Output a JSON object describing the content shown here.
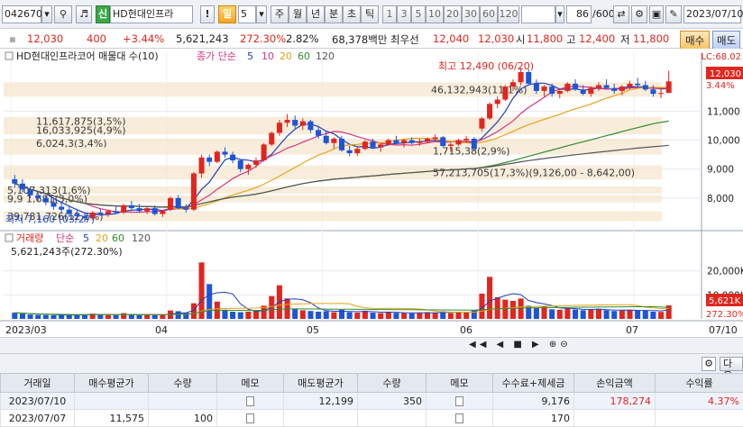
{
  "toolbar": {
    "code": "042670",
    "brand_badge": "신",
    "stock_name": "HD현대인프라",
    "period_active": "일",
    "period_count": "5",
    "periods": [
      "주",
      "월",
      "년",
      "분",
      "초",
      "틱"
    ],
    "minute_buttons": [
      "1",
      "3",
      "5",
      "10",
      "20",
      "30",
      "60",
      "120"
    ],
    "count_value": "86",
    "count_total": "/600",
    "date": "2023/07/10"
  },
  "quote": {
    "price": "12,030",
    "change": "400",
    "change_pct": "+3.44%",
    "volume": "5,621,243",
    "volume_ratio": "272.30%",
    "turnover_pct": "2.82%",
    "amount": "68,378백만",
    "priority_ask_label": "최우선",
    "priority_ask": "12,040",
    "priority_bid": "12,030",
    "open_label": "시",
    "open": "11,800",
    "high_label": "고",
    "high": "12,400",
    "low_label": "저",
    "low": "11,800",
    "buy_label": "매수",
    "sell_label": "매도"
  },
  "chart": {
    "price_title": "HD현대인프라코어 매물대 수(10)",
    "ma_label": "종가 단순",
    "ma_periods": [
      "5",
      "10",
      "20",
      "60",
      "120"
    ],
    "ma_colors": [
      "#1f3fbf",
      "#d63384",
      "#e8a317",
      "#2e8b2e",
      "#555555"
    ],
    "lc_label": "LC:68.02",
    "price_tag": "12,030",
    "pct_tag": "3.44%",
    "high_note": "최고 12,490 (06/20)",
    "low_note": "최저 7,160 (03/27)",
    "volume_title": "거래량",
    "volume_ma_label": "단순",
    "volume_value": "5,621,243주(272.30%)",
    "volume_tag": "5,621K",
    "volume_pct_tag": "272.30%",
    "x_labels": [
      "2023/03",
      "04",
      "05",
      "06",
      "07",
      "07/10"
    ],
    "up_color": "#e0261e",
    "down_color": "#1e55d6"
  },
  "chart_data": {
    "type": "candlestick",
    "price_axis": {
      "ticks": [
        8000,
        9000,
        10000,
        11000
      ],
      "ylim": [
        7000,
        12600
      ]
    },
    "volume_axis": {
      "ticks": [
        10000,
        20000
      ],
      "unit": "K",
      "ylim": [
        0,
        30000
      ]
    },
    "ohlc": [
      [
        8650,
        8800,
        8350,
        8500
      ],
      [
        8500,
        8650,
        8200,
        8300
      ],
      [
        8300,
        8400,
        8000,
        8100
      ],
      [
        8100,
        8250,
        7900,
        8000
      ],
      [
        8000,
        8100,
        7750,
        7850
      ],
      [
        7850,
        8000,
        7600,
        7700
      ],
      [
        7700,
        7850,
        7500,
        7600
      ],
      [
        7600,
        7700,
        7350,
        7450
      ],
      [
        7450,
        7600,
        7250,
        7380
      ],
      [
        7380,
        7500,
        7160,
        7300
      ],
      [
        7300,
        7550,
        7250,
        7500
      ],
      [
        7500,
        7650,
        7400,
        7450
      ],
      [
        7450,
        7600,
        7350,
        7550
      ],
      [
        7550,
        7700,
        7450,
        7500
      ],
      [
        7500,
        7800,
        7450,
        7750
      ],
      [
        7750,
        7900,
        7600,
        7650
      ],
      [
        7650,
        7800,
        7500,
        7550
      ],
      [
        7550,
        7700,
        7450,
        7650
      ],
      [
        7650,
        7750,
        7400,
        7450
      ],
      [
        7450,
        7600,
        7350,
        7550
      ],
      [
        7600,
        8050,
        7550,
        8000
      ],
      [
        8000,
        8100,
        7600,
        7650
      ],
      [
        7650,
        7800,
        7500,
        7600
      ],
      [
        7600,
        8900,
        7550,
        8850
      ],
      [
        8850,
        9500,
        8700,
        9400
      ],
      [
        9400,
        9500,
        9100,
        9250
      ],
      [
        9250,
        9650,
        9200,
        9600
      ],
      [
        9600,
        9750,
        9400,
        9500
      ],
      [
        9500,
        9600,
        9200,
        9300
      ],
      [
        9300,
        9350,
        8900,
        9000
      ],
      [
        9000,
        9200,
        8800,
        9150
      ],
      [
        9150,
        9400,
        9050,
        9300
      ],
      [
        9300,
        9900,
        9250,
        9850
      ],
      [
        9850,
        10300,
        9800,
        10250
      ],
      [
        10250,
        10700,
        10150,
        10600
      ],
      [
        10600,
        10900,
        10450,
        10700
      ],
      [
        10700,
        10850,
        10400,
        10500
      ],
      [
        10500,
        10750,
        10350,
        10650
      ],
      [
        10650,
        10700,
        10250,
        10350
      ],
      [
        10350,
        10500,
        10050,
        10150
      ],
      [
        10150,
        10300,
        9850,
        9900
      ],
      [
        9900,
        10100,
        9700,
        10050
      ],
      [
        10050,
        10150,
        9600,
        9650
      ],
      [
        9650,
        9800,
        9450,
        9550
      ],
      [
        9550,
        9750,
        9450,
        9700
      ],
      [
        9700,
        10000,
        9650,
        9950
      ],
      [
        9950,
        10050,
        9700,
        9750
      ],
      [
        9750,
        9900,
        9600,
        9850
      ],
      [
        9850,
        10050,
        9800,
        10000
      ],
      [
        10000,
        10150,
        9850,
        9900
      ],
      [
        9900,
        10050,
        9750,
        10000
      ],
      [
        10000,
        10100,
        9850,
        9900
      ],
      [
        9900,
        10050,
        9800,
        9950
      ],
      [
        9950,
        10100,
        9900,
        10050
      ],
      [
        10050,
        10200,
        9950,
        10100
      ],
      [
        10100,
        10150,
        9750,
        9800
      ],
      [
        9800,
        9950,
        9600,
        9850
      ],
      [
        9850,
        10050,
        9800,
        10000
      ],
      [
        10000,
        10150,
        9900,
        10050
      ],
      [
        10050,
        10100,
        9650,
        9700
      ],
      [
        10400,
        10800,
        10300,
        10750
      ],
      [
        10750,
        11300,
        10700,
        11250
      ],
      [
        11250,
        11500,
        11100,
        11400
      ],
      [
        11400,
        11900,
        11350,
        11850
      ],
      [
        11850,
        12100,
        11700,
        12000
      ],
      [
        12000,
        12490,
        11900,
        12350
      ],
      [
        12350,
        12450,
        11900,
        11950
      ],
      [
        11950,
        12100,
        11600,
        11700
      ],
      [
        11700,
        11900,
        11500,
        11850
      ],
      [
        11850,
        11950,
        11500,
        11600
      ],
      [
        11600,
        11800,
        11450,
        11700
      ],
      [
        11700,
        12000,
        11650,
        11950
      ],
      [
        11950,
        12100,
        11700,
        11750
      ],
      [
        11750,
        11900,
        11550,
        11600
      ],
      [
        11600,
        11850,
        11500,
        11800
      ],
      [
        11800,
        12000,
        11700,
        11900
      ],
      [
        11900,
        12100,
        11750,
        11800
      ],
      [
        11800,
        11950,
        11600,
        11700
      ],
      [
        11700,
        11900,
        11550,
        11850
      ],
      [
        11850,
        12050,
        11750,
        11950
      ],
      [
        11950,
        12150,
        11800,
        11900
      ],
      [
        11900,
        12050,
        11700,
        11750
      ],
      [
        11750,
        11900,
        11500,
        11600
      ],
      [
        11600,
        11800,
        11450,
        11630
      ],
      [
        11630,
        12400,
        11800,
        12030
      ]
    ],
    "volume_k": [
      2600,
      2200,
      1800,
      1700,
      1600,
      1500,
      1700,
      1600,
      1500,
      1900,
      2200,
      1800,
      1600,
      1500,
      2400,
      1800,
      1500,
      1700,
      1600,
      1800,
      3500,
      3200,
      2600,
      6500,
      23500,
      14500,
      7200,
      3800,
      3000,
      2800,
      3000,
      3200,
      5500,
      9500,
      14000,
      8500,
      4200,
      3600,
      3300,
      3000,
      3200,
      2800,
      3800,
      2800,
      2600,
      3400,
      2600,
      2400,
      3000,
      2500,
      2400,
      2300,
      2500,
      2800,
      2600,
      3200,
      2400,
      3000,
      2600,
      3500,
      10500,
      17500,
      9000,
      8000,
      7500,
      8500,
      5500,
      4500,
      5200,
      4000,
      3800,
      4500,
      3900,
      3600,
      3800,
      4200,
      3600,
      3300,
      3500,
      3800,
      3600,
      3400,
      3000,
      2900,
      5621
    ],
    "volume_profile": [
      {
        "label": "46,132,943(11,1%)",
        "low": 11500,
        "high": 12000
      },
      {
        "label": "11,617,875(3,5%)",
        "low": 10500,
        "high": 10800
      },
      {
        "label": "16,033,925(4,9%)",
        "low": 10200,
        "high": 10500
      },
      {
        "label": "6,024,3(3,4%)",
        "low": 9750,
        "high": 10050
      },
      {
        "label": "1,715,38(2,9%)",
        "low": 9500,
        "high": 9750
      },
      {
        "label": "57,213,705(17,3%)(9,126,00 - 8,642,00)",
        "low": 8642,
        "high": 9126
      },
      {
        "label": "5,107,313(1,6%)",
        "low": 8150,
        "high": 8400
      },
      {
        "label": "9,9 1,681(3,0%)",
        "low": 7850,
        "high": 8100
      },
      {
        "label": "39,781,726(12,1%)",
        "low": 7200,
        "high": 7550
      }
    ]
  },
  "trades_table": {
    "headers": [
      "거래일",
      "매수평균가",
      "수량",
      "메모",
      "매도평균가",
      "수량",
      "메모",
      "수수료+제세금",
      "손익금액",
      "수익률"
    ],
    "rows": [
      [
        "2023/07/10",
        "",
        "",
        "memo",
        "12,199",
        "350",
        "memo",
        "9,176",
        "178,274",
        "4.37%"
      ],
      [
        "2023/07/07",
        "11,575",
        "100",
        "memo",
        "",
        "",
        "memo",
        "170",
        "",
        ""
      ]
    ],
    "next_button": "다음"
  }
}
